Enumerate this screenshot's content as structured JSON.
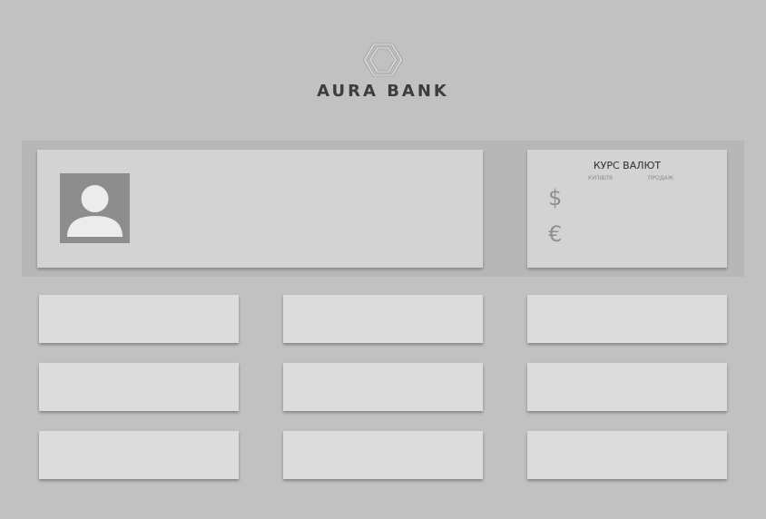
{
  "brand": {
    "name": "AURA BANK",
    "logo_icon": "hexagon-logo-icon"
  },
  "profile": {
    "avatar_icon": "user-avatar-icon"
  },
  "rates": {
    "title": "КУРС ВАЛЮТ",
    "col_buy": "КУПІВЛЯ",
    "col_sell": "ПРОДАЖ",
    "currencies": [
      {
        "symbol": "$",
        "icon": "dollar-icon"
      },
      {
        "symbol": "€",
        "icon": "euro-icon"
      }
    ]
  },
  "menu": {
    "tiles": [
      {
        "id": "tile-1"
      },
      {
        "id": "tile-2"
      },
      {
        "id": "tile-3"
      },
      {
        "id": "tile-4"
      },
      {
        "id": "tile-5"
      },
      {
        "id": "tile-6"
      },
      {
        "id": "tile-7"
      },
      {
        "id": "tile-8"
      },
      {
        "id": "tile-9"
      }
    ]
  },
  "colors": {
    "background": "#c1c1c1",
    "band": "#b7b7b7",
    "card": "#d3d3d3",
    "tile": "#dcdcdc",
    "avatar": "#8d8d8d"
  }
}
